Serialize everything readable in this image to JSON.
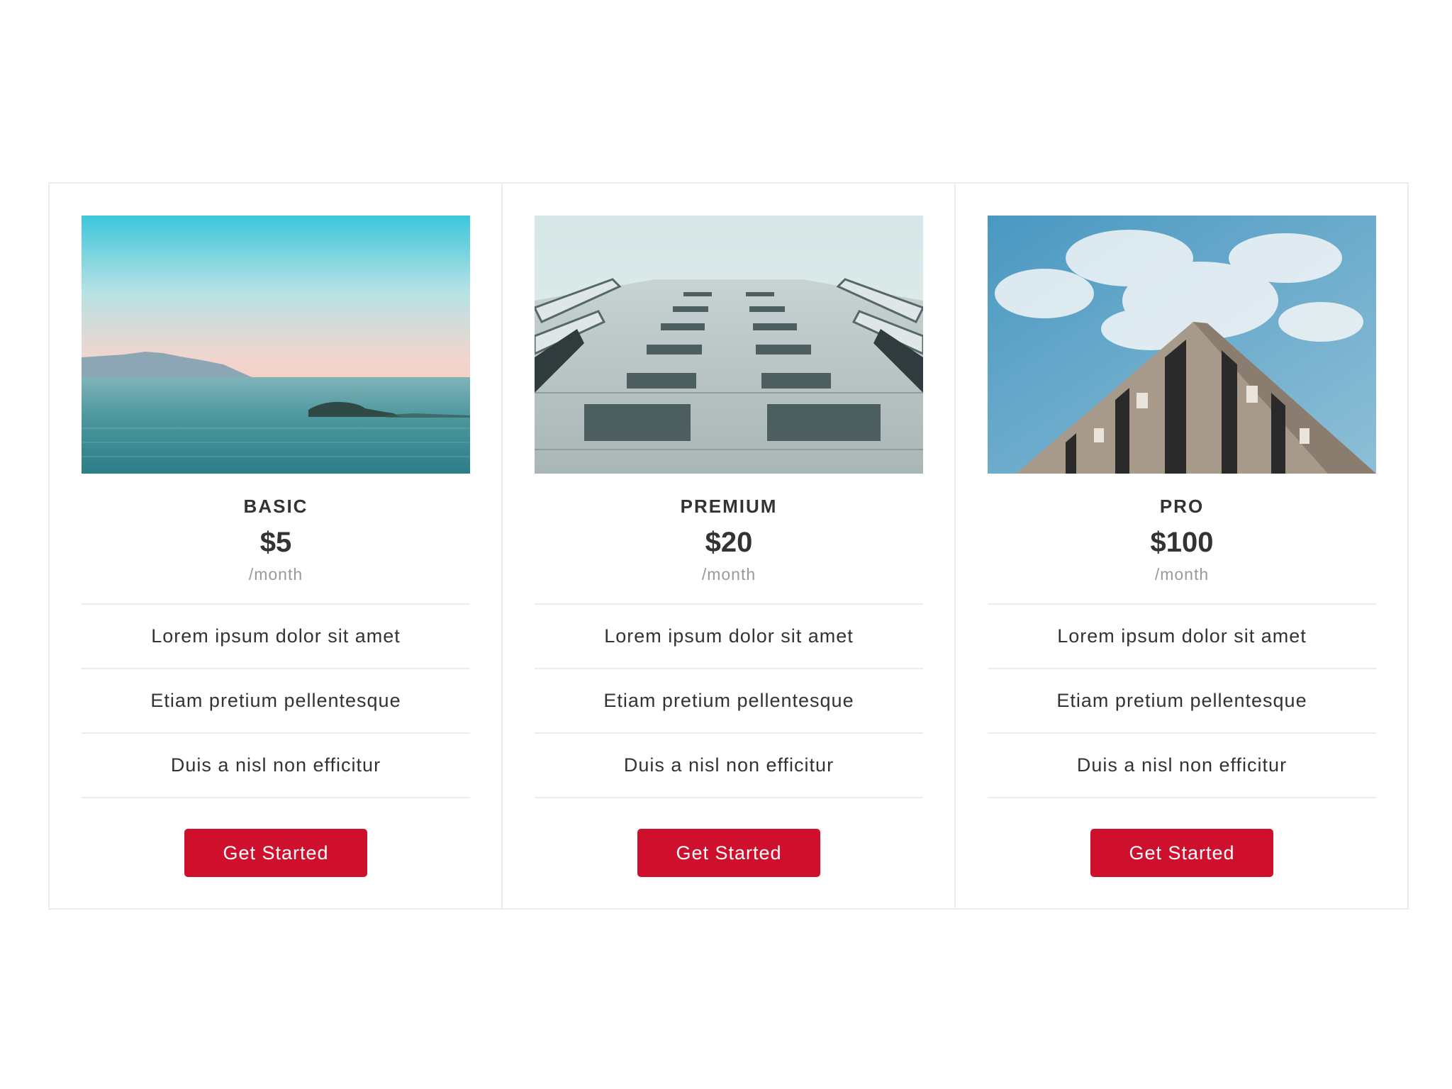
{
  "plans": [
    {
      "image": "sea-landscape-photo",
      "name": "BASIC",
      "price": "$5",
      "period": "/month",
      "features": [
        "Lorem ipsum dolor sit amet",
        "Etiam pretium pellentesque",
        "Duis a nisl non efficitur"
      ],
      "cta_label": "Get Started"
    },
    {
      "image": "building-facade-photo",
      "name": "PREMIUM",
      "price": "$20",
      "period": "/month",
      "features": [
        "Lorem ipsum dolor sit amet",
        "Etiam pretium pellentesque",
        "Duis a nisl non efficitur"
      ],
      "cta_label": "Get Started"
    },
    {
      "image": "building-corner-sky-photo",
      "name": "PRO",
      "price": "$100",
      "period": "/month",
      "features": [
        "Lorem ipsum dolor sit amet",
        "Etiam pretium pellentesque",
        "Duis a nisl non efficitur"
      ],
      "cta_label": "Get Started"
    }
  ],
  "colors": {
    "accent": "#cf102d",
    "text": "#333333",
    "muted": "#999999",
    "border": "#ececec"
  }
}
